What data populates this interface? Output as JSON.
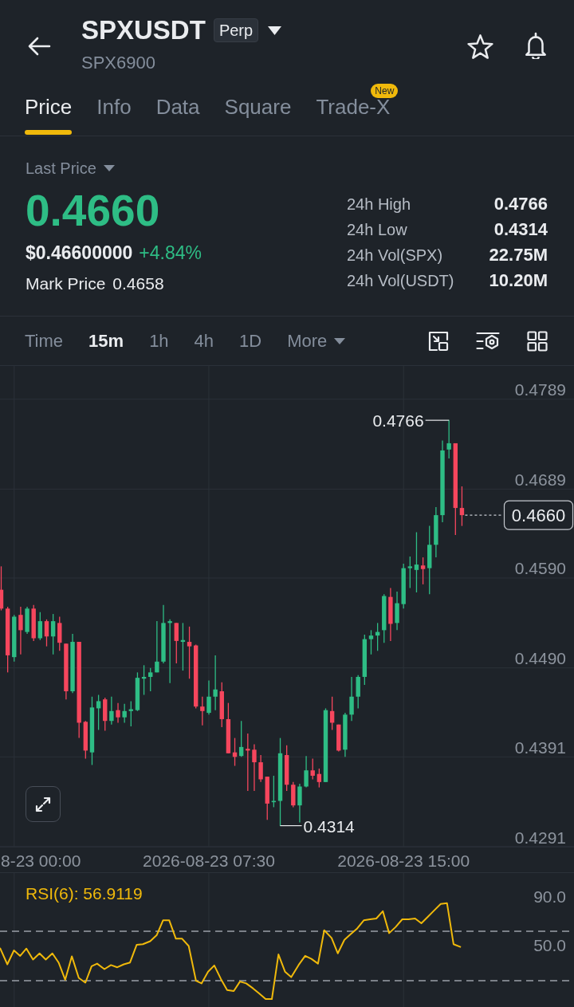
{
  "header": {
    "symbol": "SPXUSDT",
    "badge": "Perp",
    "subtitle": "SPX6900",
    "favorite": false
  },
  "tabs": [
    {
      "label": "Price",
      "selected": true
    },
    {
      "label": "Info",
      "selected": false
    },
    {
      "label": "Data",
      "selected": false
    },
    {
      "label": "Square",
      "selected": false
    },
    {
      "label": "Trade-X",
      "selected": false,
      "badge": "New"
    }
  ],
  "price_summary": {
    "selector": "Last Price",
    "last_price": "0.4660",
    "usd_price": "$0.46600000",
    "change": "+4.84%",
    "mark_price_label": "Mark Price",
    "mark_price": "0.4658"
  },
  "stats": [
    {
      "label": "24h High",
      "value": "0.4766"
    },
    {
      "label": "24h Low",
      "value": "0.4314"
    },
    {
      "label": "24h Vol(SPX)",
      "value": "22.75M"
    },
    {
      "label": "24h Vol(USDT)",
      "value": "10.20M"
    }
  ],
  "intervals": [
    {
      "label": "Time",
      "kind": "option",
      "selected": false
    },
    {
      "label": "15m",
      "kind": "option",
      "selected": true
    },
    {
      "label": "1h",
      "kind": "option",
      "selected": false
    },
    {
      "label": "4h",
      "kind": "option",
      "selected": false
    },
    {
      "label": "1D",
      "kind": "option",
      "selected": false
    },
    {
      "label": "More",
      "kind": "menu",
      "selected": false
    }
  ],
  "chart": {
    "edge_time_label": "8-23 00:00",
    "chart_data": {
      "type": "candlestick",
      "categories": [
        null,
        null,
        null,
        null,
        null,
        null,
        null,
        null,
        null,
        null,
        null,
        null,
        null,
        null,
        null,
        null,
        null,
        null,
        null,
        null,
        null,
        null,
        null,
        null,
        null,
        null,
        null,
        null,
        null,
        null,
        null,
        null,
        "2026-08-23 07:30",
        null,
        null,
        null,
        null,
        null,
        null,
        null,
        null,
        null,
        null,
        null,
        null,
        null,
        null,
        null,
        null,
        null,
        null,
        null,
        null,
        null,
        null,
        null,
        null,
        null,
        null,
        null,
        null,
        null,
        "2026-08-23 15:00",
        null,
        null,
        null,
        null,
        null,
        null,
        null,
        null,
        null
      ],
      "ohlc": [
        [
          0.4577,
          0.4603,
          0.4554,
          0.4556
        ],
        [
          0.4556,
          0.4558,
          0.4485,
          0.4504
        ],
        [
          0.4502,
          0.4549,
          0.4497,
          0.4547
        ],
        [
          0.4549,
          0.4558,
          0.4505,
          0.4532
        ],
        [
          0.453,
          0.4558,
          0.4528,
          0.4556
        ],
        [
          0.4556,
          0.456,
          0.452,
          0.4523
        ],
        [
          0.4523,
          0.4552,
          0.4521,
          0.4542
        ],
        [
          0.4542,
          0.4544,
          0.4514,
          0.4525
        ],
        [
          0.4525,
          0.455,
          0.4505,
          0.4542
        ],
        [
          0.454,
          0.4547,
          0.4509,
          0.4518
        ],
        [
          0.4517,
          0.4517,
          0.4455,
          0.4464
        ],
        [
          0.4464,
          0.4528,
          0.4462,
          0.4519
        ],
        [
          0.4519,
          0.4519,
          0.4412,
          0.4429
        ],
        [
          0.443,
          0.4431,
          0.4389,
          0.4398
        ],
        [
          0.4396,
          0.4458,
          0.4382,
          0.4446
        ],
        [
          0.4445,
          0.446,
          0.4421,
          0.4453
        ],
        [
          0.4455,
          0.4457,
          0.442,
          0.4431
        ],
        [
          0.4431,
          0.4458,
          0.4427,
          0.4442
        ],
        [
          0.4443,
          0.4451,
          0.4429,
          0.4435
        ],
        [
          0.4435,
          0.445,
          0.4429,
          0.4442
        ],
        [
          0.4442,
          0.4453,
          0.4425,
          0.4444
        ],
        [
          0.4443,
          0.4485,
          0.4442,
          0.4479
        ],
        [
          0.4478,
          0.4493,
          0.446,
          0.448
        ],
        [
          0.448,
          0.449,
          0.4464,
          0.4485
        ],
        [
          0.4485,
          0.4542,
          0.4485,
          0.4497
        ],
        [
          0.4497,
          0.456,
          0.4495,
          0.454
        ],
        [
          0.454,
          0.4544,
          0.4473,
          0.4542
        ],
        [
          0.454,
          0.454,
          0.4495,
          0.452
        ],
        [
          0.4519,
          0.454,
          0.4487,
          0.4521
        ],
        [
          0.4519,
          0.4536,
          0.4478,
          0.4514
        ],
        [
          0.4515,
          0.4516,
          0.4445,
          0.4447
        ],
        [
          0.4447,
          0.4458,
          0.4426,
          0.4442
        ],
        [
          0.444,
          0.4476,
          0.4438,
          0.4458
        ],
        [
          0.4458,
          0.4504,
          0.4443,
          0.4466
        ],
        [
          0.4464,
          0.4474,
          0.4424,
          0.4433
        ],
        [
          0.4433,
          0.4451,
          0.4395,
          0.4395
        ],
        [
          0.4396,
          0.4412,
          0.4381,
          0.4391
        ],
        [
          0.4392,
          0.4431,
          0.4391,
          0.4402
        ],
        [
          0.44,
          0.4417,
          0.4353,
          0.4398
        ],
        [
          0.4399,
          0.4405,
          0.4353,
          0.4385
        ],
        [
          0.4385,
          0.4393,
          0.4363,
          0.4366
        ],
        [
          0.4369,
          0.4369,
          0.4321,
          0.4339
        ],
        [
          0.4341,
          0.437,
          0.4335,
          0.4342
        ],
        [
          0.4342,
          0.4412,
          0.4314,
          0.4395
        ],
        [
          0.4393,
          0.4404,
          0.4353,
          0.436
        ],
        [
          0.436,
          0.4363,
          0.4335,
          0.4337
        ],
        [
          0.4337,
          0.4361,
          0.4318,
          0.4358
        ],
        [
          0.4358,
          0.4392,
          0.4357,
          0.4376
        ],
        [
          0.4376,
          0.4389,
          0.4366,
          0.437
        ],
        [
          0.4372,
          0.4378,
          0.4357,
          0.4363
        ],
        [
          0.4363,
          0.4445,
          0.4363,
          0.4443
        ],
        [
          0.4442,
          0.4458,
          0.4421,
          0.4429
        ],
        [
          0.4427,
          0.4427,
          0.4397,
          0.4398
        ],
        [
          0.4399,
          0.444,
          0.4391,
          0.4438
        ],
        [
          0.4438,
          0.448,
          0.4431,
          0.4458
        ],
        [
          0.4458,
          0.4482,
          0.4445,
          0.448
        ],
        [
          0.448,
          0.4527,
          0.4471,
          0.4522
        ],
        [
          0.4522,
          0.4532,
          0.4505,
          0.4526
        ],
        [
          0.4526,
          0.454,
          0.4509,
          0.453
        ],
        [
          0.4532,
          0.4572,
          0.4518,
          0.457
        ],
        [
          0.4569,
          0.4579,
          0.452,
          0.4539
        ],
        [
          0.454,
          0.4575,
          0.4532,
          0.4562
        ],
        [
          0.4561,
          0.4606,
          0.4556,
          0.4601
        ],
        [
          0.4601,
          0.4614,
          0.4579,
          0.4603
        ],
        [
          0.4599,
          0.4641,
          0.4574,
          0.4605
        ],
        [
          0.4604,
          0.4613,
          0.4583,
          0.46
        ],
        [
          0.4601,
          0.4648,
          0.4572,
          0.4627
        ],
        [
          0.4627,
          0.4669,
          0.4613,
          0.466
        ],
        [
          0.466,
          0.4743,
          0.4652,
          0.4732
        ],
        [
          0.4733,
          0.4766,
          0.4723,
          0.474
        ],
        [
          0.474,
          0.474,
          0.4638,
          0.4668
        ],
        [
          0.4668,
          0.4692,
          0.4648,
          0.466
        ]
      ],
      "ylim": [
        0.4291,
        0.4826
      ],
      "yticks": [
        {
          "value": 0.4789,
          "label": "0.4789"
        },
        {
          "value": 0.4689,
          "label": "0.4689"
        },
        {
          "value": 0.459,
          "label": "0.4590"
        },
        {
          "value": 0.449,
          "label": "0.4490"
        },
        {
          "value": 0.4391,
          "label": "0.4391"
        },
        {
          "value": 0.4291,
          "label": "0.4291"
        }
      ],
      "grid": true,
      "annotations": [
        "0.4766",
        "0.4314"
      ],
      "ref_lines": [
        {
          "axis": "y",
          "value": 0.466,
          "label": "0.4660"
        }
      ]
    }
  },
  "rsi": {
    "label": "RSI(6): 56.9119",
    "scale_labels": [
      "90.0",
      "50.0"
    ]
  }
}
